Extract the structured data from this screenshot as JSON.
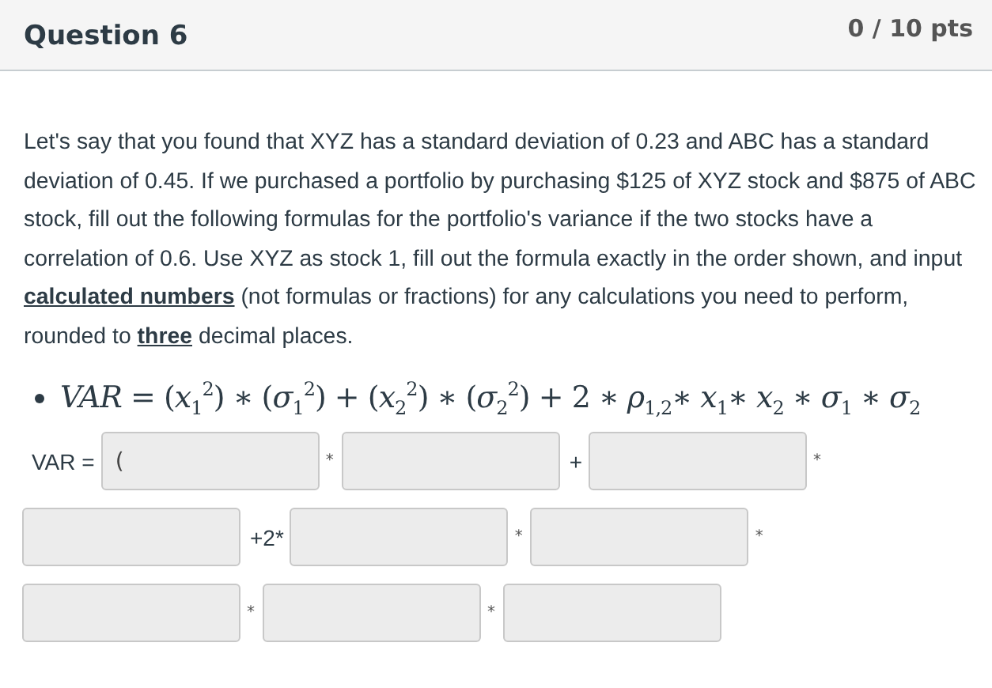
{
  "header": {
    "title": "Question 6",
    "points": "0 / 10 pts"
  },
  "question": "Let's say that you found that XYZ has a standard deviation of 0.23 and ABC has a standard deviation of 0.45. If we purchased a portfolio by purchasing $125 of XYZ stock and $875 of ABC stock, fill out the following formulas for the portfolio's variance if the two stocks have a correlation of 0.6. Use XYZ as stock 1, fill out the formula exactly in the order shown, and input **calculated numbers** (not formulas or fractions) for any calculations you need to perform, rounded to **three** decimal places.",
  "formula": "*VAR* = (*x*$_{1}$$^{2}$) ∗ (*σ*$_{1}$$^{2}$) + (*x*$_{2}$$^{2}$) ∗ (*σ*$_{2}$$^{2}$) +  2 ∗ *ρ*$_{1,2}$∗ *x*$_{1}$∗ *x*$_{2}$ ∗ *σ*$_{1}$ ∗ *σ*$_{2}$",
  "answer_rows": [
    [
      {
        "kind": "label",
        "text": "VAR ="
      },
      {
        "kind": "field",
        "value": "("
      },
      {
        "kind": "op",
        "text": "*"
      },
      {
        "kind": "field"
      },
      {
        "kind": "label",
        "text": "+"
      },
      {
        "kind": "field"
      },
      {
        "kind": "op",
        "text": "*"
      }
    ],
    [
      {
        "kind": "field"
      },
      {
        "kind": "label",
        "text": "+2*"
      },
      {
        "kind": "field"
      },
      {
        "kind": "op",
        "text": "*"
      },
      {
        "kind": "field"
      },
      {
        "kind": "op",
        "text": "*"
      }
    ],
    [
      {
        "kind": "field"
      },
      {
        "kind": "op",
        "text": "*"
      },
      {
        "kind": "field"
      },
      {
        "kind": "op",
        "text": "*"
      },
      {
        "kind": "field"
      }
    ]
  ]
}
